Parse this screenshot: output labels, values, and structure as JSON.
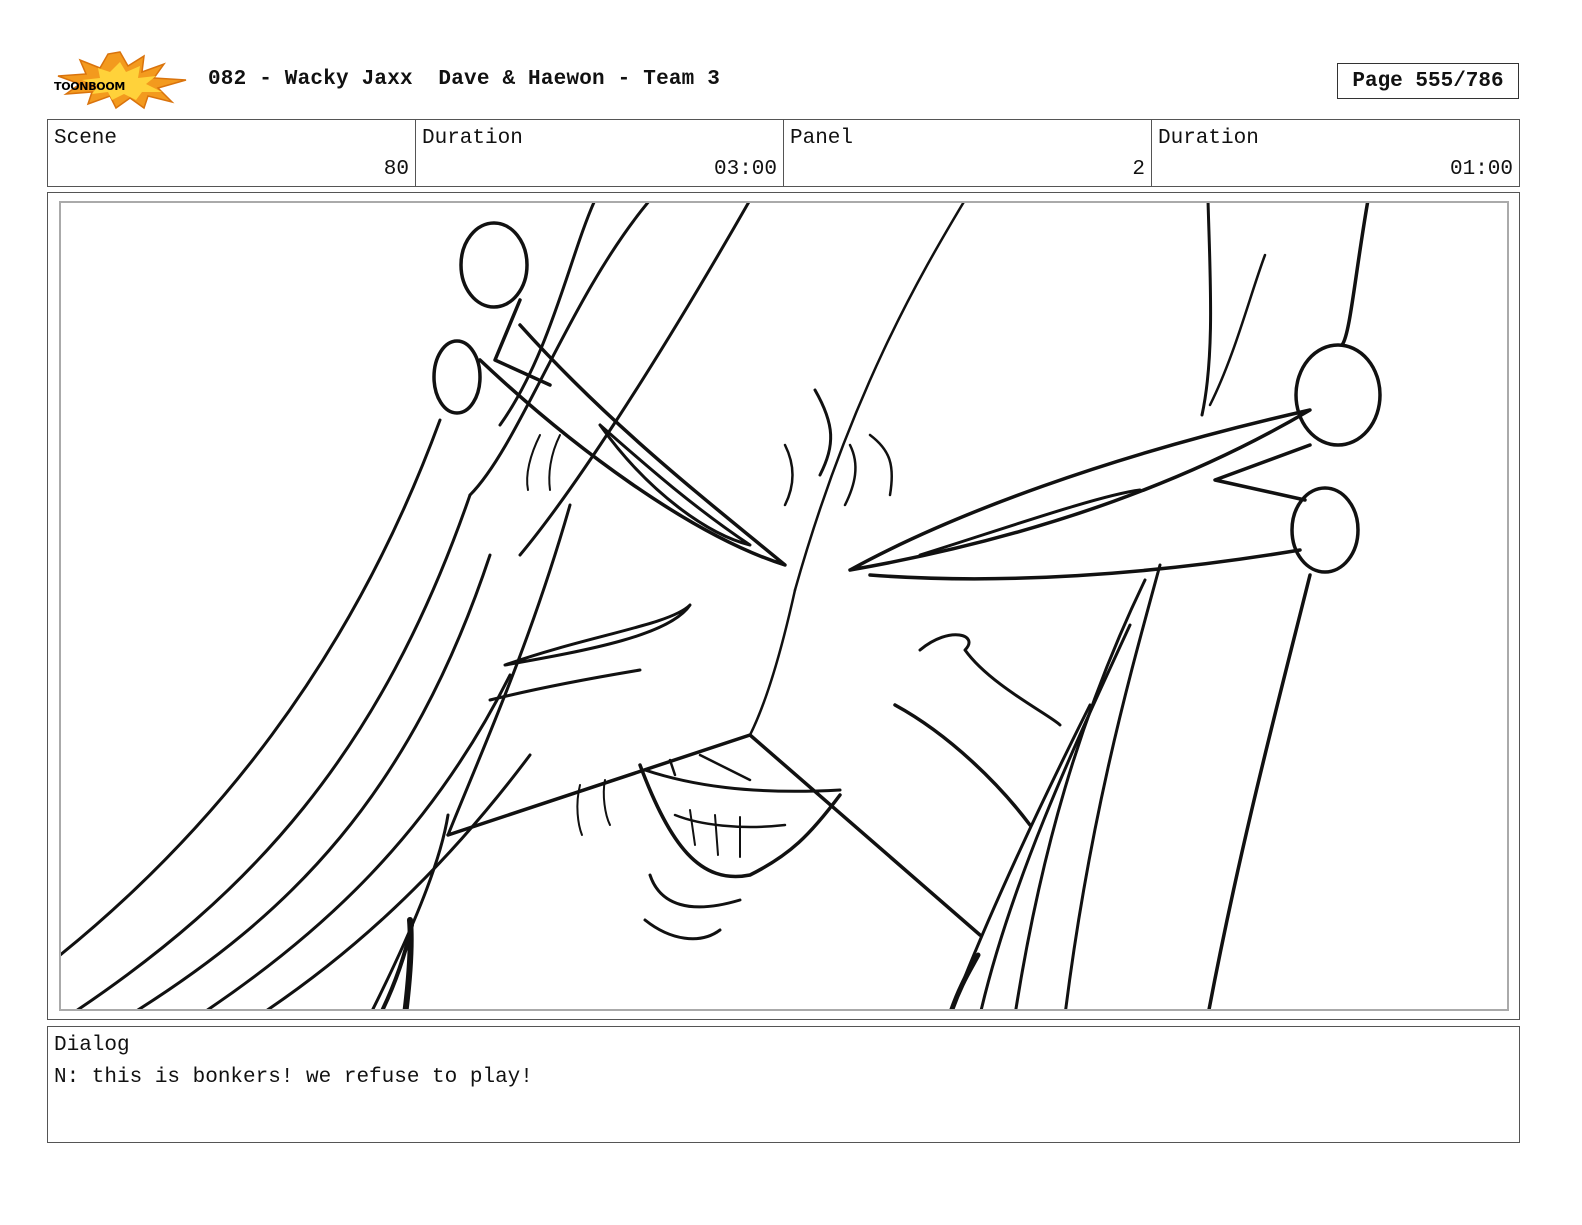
{
  "header": {
    "logo_text": "TOONBOOM",
    "title": "082 - Wacky Jaxx  Dave & Haewon - Team 3",
    "page": "Page 555/786"
  },
  "info": {
    "scene_label": "Scene",
    "scene_value": "80",
    "scene_duration_label": "Duration",
    "scene_duration_value": "03:00",
    "panel_label": "Panel",
    "panel_value": "2",
    "panel_duration_label": "Duration",
    "panel_duration_value": "01:00"
  },
  "dialog": {
    "label": "Dialog",
    "text": "N: this is bonkers! we refuse to play!"
  },
  "colors": {
    "logo_burst": "#f39a1e",
    "logo_burst_inner": "#ffd23a",
    "ink": "#111111"
  }
}
